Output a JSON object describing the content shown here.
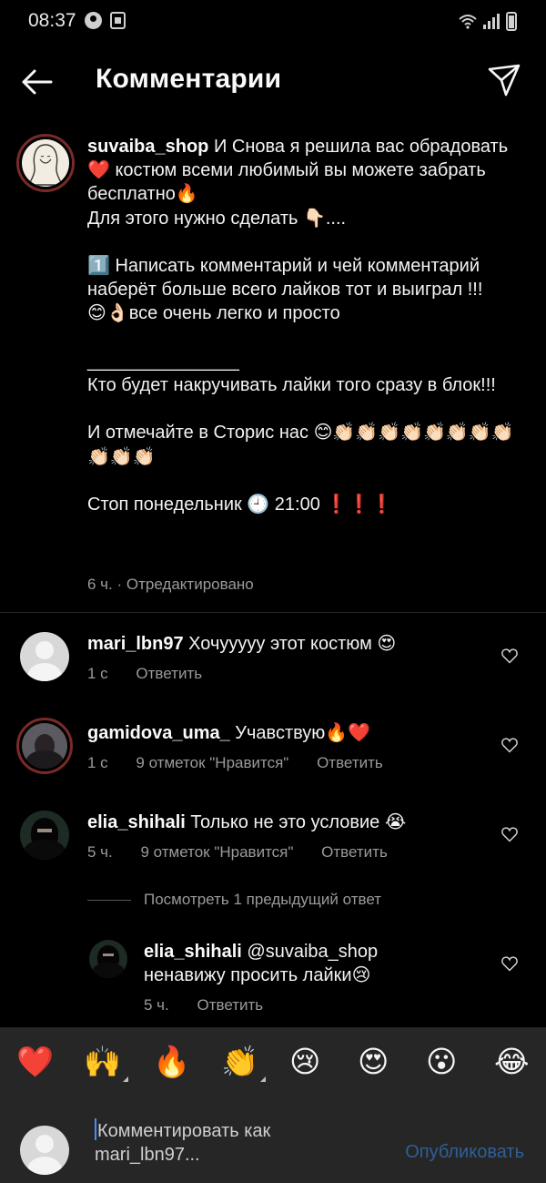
{
  "status_bar": {
    "time": "08:37"
  },
  "header": {
    "title": "Комментарии",
    "back_icon": "arrow-left-icon",
    "send_icon": "paper-plane-icon"
  },
  "caption": {
    "username": "suvaiba_shop",
    "text": " И Снова я решила вас обрадовать ❤️ костюм всеми любимый вы можете забрать бесплатно🔥\nДля этого нужно сделать 👇🏻....\n\n1️⃣ Написать комментарий и чей комментарий наберёт больше всего лайков тот и выиграл !!!\n😊👌🏻все очень легко и просто\n\n_______________\nКто будет накручивать лайки того сразу в блок!!!\n\nИ отмечайте в Сторис нас 😊👏🏻👏🏻👏🏻👏🏻👏🏻👏🏻👏🏻👏🏻👏🏻👏🏻👏🏻\n\nСтоп понедельник 🕘 21:00 ❗❗❗",
    "time": "6 ч.",
    "edited": "· Отредактировано"
  },
  "comments": [
    {
      "username": "mari_lbn97",
      "text": " Хочууууу этот костюм 😍",
      "time": "1 с",
      "likes": "",
      "reply": "Ответить"
    },
    {
      "username": "gamidova_uma_",
      "text": " Учавствую🔥❤️",
      "time": "1 с",
      "likes": "9 отметок \"Нравится\"",
      "reply": "Ответить"
    },
    {
      "username": "elia_shihali",
      "text": " Только не это условие 😭",
      "time": "5 ч.",
      "likes": "9 отметок \"Нравится\"",
      "reply": "Ответить"
    }
  ],
  "view_previous": "Посмотреть 1 предыдущий ответ",
  "reply": {
    "username": "elia_shihali",
    "text": " @suvaiba_shop ненавижу просить лайки😢",
    "time": "5 ч.",
    "reply": "Ответить"
  },
  "emoji_bar": [
    "❤️",
    "🙌",
    "🔥",
    "👏",
    "😢",
    "😍",
    "😮",
    "😂"
  ],
  "composer": {
    "placeholder": "Комментировать как mari_lbn97...",
    "publish": "Опубликовать"
  },
  "colors": {
    "background": "#000000",
    "secondary_text": "#9a9a9a",
    "publish_disabled": "#2f5f96",
    "bar": "#262626"
  }
}
